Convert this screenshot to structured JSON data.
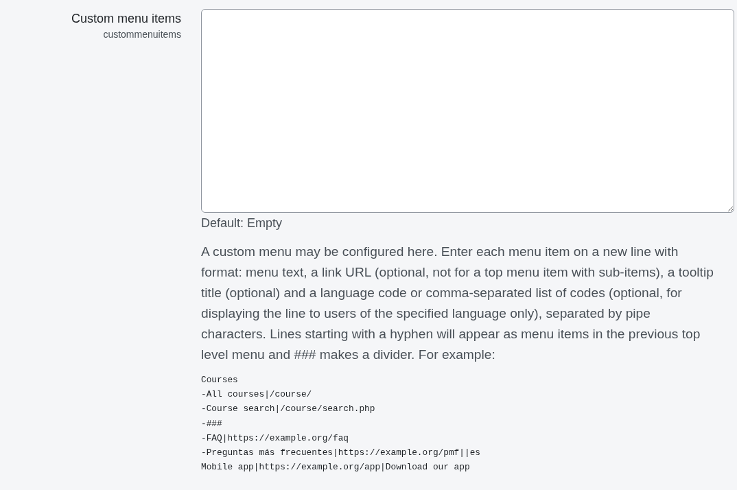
{
  "setting": {
    "label": "Custom menu items",
    "name": "custommenuitems"
  },
  "default": "Default: Empty",
  "description": "A custom menu may be configured here. Enter each menu item on a new line with format: menu text, a link URL (optional, not for a top menu item with sub-items), a tooltip title (optional) and a language code or comma-separated list of codes (optional, for displaying the line to users of the specified language only), separated by pipe characters. Lines starting with a hyphen will appear as menu items in the previous top level menu and ### makes a divider. For example:",
  "example": [
    "Courses",
    "-All courses|/course/",
    "-Course search|/course/search.php",
    "-###",
    "-FAQ|https://example.org/faq",
    "-Preguntas más frecuentes|https://example.org/pmf||es",
    "Mobile app|https://example.org/app|Download our app"
  ]
}
